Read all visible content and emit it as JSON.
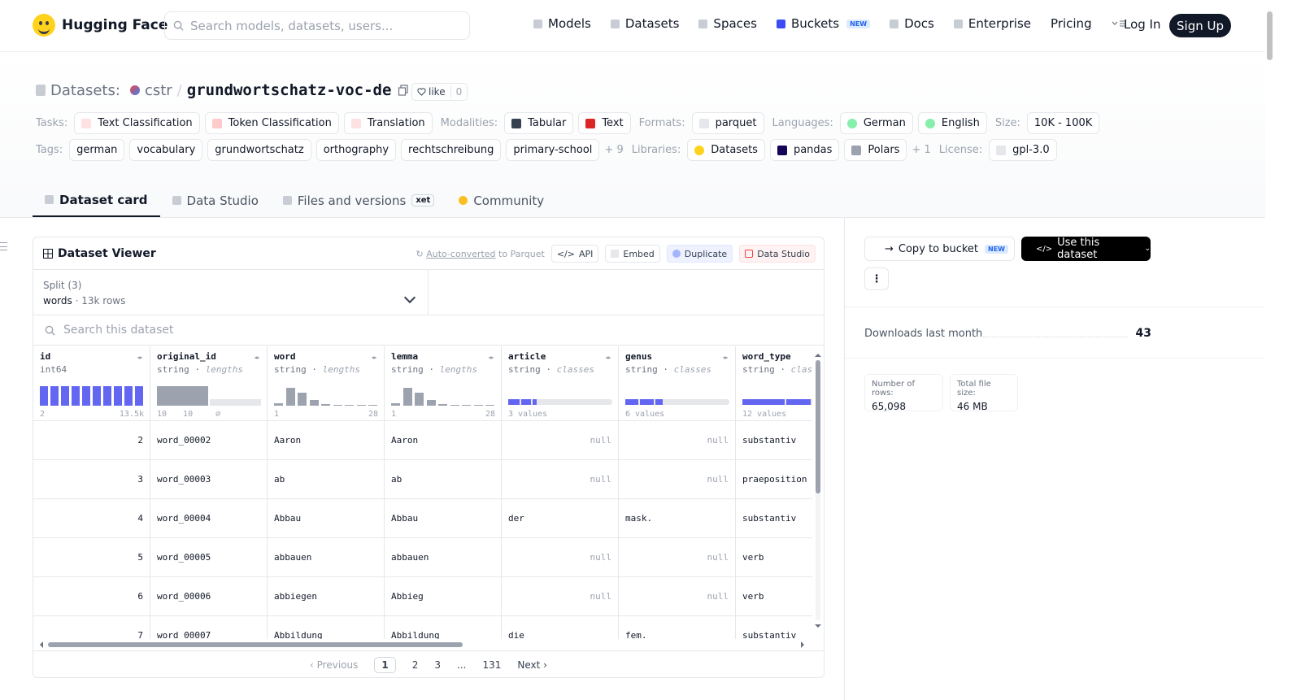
{
  "header": {
    "brand": "Hugging Face",
    "search_placeholder": "Search models, datasets, users...",
    "nav": [
      {
        "label": "Models",
        "icon": "cube-icon"
      },
      {
        "label": "Datasets",
        "icon": "database-icon"
      },
      {
        "label": "Spaces",
        "icon": "grid-icon"
      },
      {
        "label": "Buckets",
        "icon": "bucket-icon",
        "badge": "NEW"
      },
      {
        "label": "Docs",
        "icon": "book-icon"
      },
      {
        "label": "Enterprise",
        "icon": "building-icon"
      },
      {
        "label": "Pricing"
      }
    ],
    "login": "Log In",
    "signup": "Sign Up"
  },
  "repo": {
    "prefix": "Datasets:",
    "owner": "cstr",
    "sep": "/",
    "name": "grundwortschatz-voc-de",
    "like_label": "like",
    "like_count": "0"
  },
  "meta": {
    "tasks_label": "Tasks:",
    "tasks": [
      "Text Classification",
      "Token Classification",
      "Translation"
    ],
    "modalities_label": "Modalities:",
    "modalities": [
      "Tabular",
      "Text"
    ],
    "formats_label": "Formats:",
    "formats": [
      "parquet"
    ],
    "languages_label": "Languages:",
    "languages": [
      "German",
      "English"
    ],
    "size_label": "Size:",
    "size": "10K - 100K",
    "tags_label": "Tags:",
    "tags": [
      "german",
      "vocabulary",
      "grundwortschatz",
      "orthography",
      "rechtschreibung",
      "primary-school"
    ],
    "tags_more": "+ 9",
    "libraries_label": "Libraries:",
    "libraries": [
      "Datasets",
      "pandas",
      "Polars"
    ],
    "libraries_more": "+ 1",
    "license_label": "License:",
    "license": "gpl-3.0"
  },
  "tabs": [
    {
      "label": "Dataset card",
      "active": true
    },
    {
      "label": "Data Studio"
    },
    {
      "label": "Files and versions",
      "badge": "xet"
    },
    {
      "label": "Community"
    }
  ],
  "viewer": {
    "title": "Dataset Viewer",
    "auto_converted": "Auto-converted",
    "to_parquet": "to Parquet",
    "buttons": [
      "API",
      "Embed",
      "Duplicate",
      "Data Studio"
    ],
    "split_label": "Split (3)",
    "split_value": "words",
    "split_rows": "13k rows",
    "search_placeholder": "Search this dataset",
    "columns": [
      {
        "name": "id",
        "type": "int64",
        "stat": "",
        "foot_l": "2",
        "foot_r": "13.5k"
      },
      {
        "name": "original_id",
        "type": "string",
        "stat": "lengths",
        "foot_l": "10",
        "foot_m": "10",
        "foot_r": "⌀"
      },
      {
        "name": "word",
        "type": "string",
        "stat": "lengths",
        "foot_l": "1",
        "foot_r": "28"
      },
      {
        "name": "lemma",
        "type": "string",
        "stat": "lengths",
        "foot_l": "1",
        "foot_r": "28"
      },
      {
        "name": "article",
        "type": "string",
        "stat": "classes",
        "foot_l": "3 values",
        "foot_r": ""
      },
      {
        "name": "genus",
        "type": "string",
        "stat": "classes",
        "foot_l": "6 values",
        "foot_r": ""
      },
      {
        "name": "word_type",
        "type": "string",
        "stat": "classes",
        "foot_l": "12 values",
        "foot_r": ""
      }
    ],
    "rows": [
      [
        "2",
        "word_00002",
        "Aaron",
        "Aaron",
        null,
        null,
        "substantiv"
      ],
      [
        "3",
        "word_00003",
        "ab",
        "ab",
        null,
        null,
        "praeposition"
      ],
      [
        "4",
        "word_00004",
        "Abbau",
        "Abbau",
        "der",
        "mask.",
        "substantiv"
      ],
      [
        "5",
        "word_00005",
        "abbauen",
        "abbauen",
        null,
        null,
        "verb"
      ],
      [
        "6",
        "word_00006",
        "abbiegen",
        "Abbieg",
        null,
        null,
        "verb"
      ],
      [
        "7",
        "word_00007",
        "Abbildung",
        "Abbildung",
        "die",
        "fem.",
        "substantiv"
      ]
    ],
    "null_text": "null",
    "pager": {
      "prev": "Previous",
      "pages": [
        "1",
        "2",
        "3",
        "...",
        "131"
      ],
      "current": "1",
      "next": "Next"
    }
  },
  "sidebar": {
    "copy_label": "Copy to bucket",
    "copy_badge": "NEW",
    "use_label": "Use this dataset",
    "downloads_label": "Downloads last month",
    "downloads_value": "43",
    "rows_label": "Number of rows:",
    "rows_value": "65,098",
    "size_label": "Total file size:",
    "size_value": "46 MB"
  },
  "colors": {
    "accent": "#6366f1",
    "hist_gray": "#9ca3af",
    "dark": "#111827"
  }
}
